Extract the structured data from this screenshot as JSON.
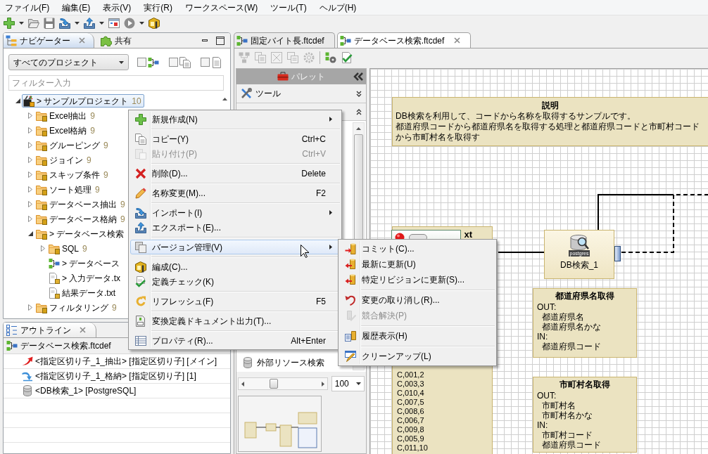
{
  "menu_bar": [
    "ファイル(F)",
    "編集(E)",
    "表示(V)",
    "実行(R)",
    "ワークスペース(W)",
    "ツール(T)",
    "ヘルプ(H)"
  ],
  "navigator": {
    "tabs": [
      {
        "kind": "navigator",
        "label": "ナビゲーター",
        "selected": true
      },
      {
        "kind": "share",
        "label": "共有",
        "selected": false
      }
    ],
    "project_scope": {
      "value": "すべてのプロジェクト"
    },
    "toggles": [
      {
        "kind": "flow",
        "checked": false
      },
      {
        "kind": "copy",
        "checked": false
      },
      {
        "kind": "doc",
        "checked": false
      }
    ],
    "filter": {
      "placeholder": "フィルター入力"
    },
    "tree": [
      {
        "kind": "project",
        "label": "> サンプルプロジェクト",
        "count": "10",
        "expanded": true,
        "selected": true,
        "children": [
          {
            "kind": "folder",
            "label": "Excel抽出",
            "count": "9",
            "expanded": false,
            "selected": false
          },
          {
            "kind": "folder",
            "label": "Excel格納",
            "count": "9",
            "expanded": false,
            "selected": false
          },
          {
            "kind": "folder",
            "label": "グルーピング",
            "count": "9",
            "expanded": false,
            "selected": false
          },
          {
            "kind": "folder",
            "label": "ジョイン",
            "count": "9",
            "expanded": false,
            "selected": false
          },
          {
            "kind": "folder",
            "label": "スキップ条件",
            "count": "9",
            "expanded": false,
            "selected": false
          },
          {
            "kind": "folder",
            "label": "ソート処理",
            "count": "9",
            "expanded": false,
            "selected": false
          },
          {
            "kind": "folder",
            "label": "データベース抽出",
            "count": "9",
            "expanded": false,
            "selected": false
          },
          {
            "kind": "folder",
            "label": "データベース格納",
            "count": "9",
            "expanded": false,
            "selected": false
          },
          {
            "kind": "folder",
            "label": "> データベース検索",
            "expanded": true,
            "selected": false,
            "children": [
              {
                "kind": "folder",
                "label": "SQL",
                "count": "9",
                "expanded": false,
                "selected": false
              },
              {
                "kind": "flow",
                "label": "> データベース",
                "selected": false
              },
              {
                "kind": "file",
                "label": "> 入力データ.tx",
                "selected": false
              },
              {
                "kind": "file",
                "label": "結果データ.txt",
                "selected": false
              }
            ]
          },
          {
            "kind": "folder",
            "label": "フィルタリング",
            "count": "9",
            "expanded": false,
            "selected": false
          }
        ]
      }
    ]
  },
  "outline": {
    "tab": {
      "label": "アウトライン"
    },
    "root": {
      "label": "データベース検索.ftcdef"
    },
    "items": [
      {
        "kind": "extract",
        "label": "<指定区切り子_1_抽出> [指定区切り子] [メイン]"
      },
      {
        "kind": "store",
        "label": "<指定区切り子_1_格納> [指定区切り子] [1]"
      },
      {
        "kind": "database",
        "label": "<DB検索_1> [PostgreSQL]"
      }
    ]
  },
  "editor": {
    "tabs": [
      {
        "label": "固定バイト長.ftcdef",
        "selected": false
      },
      {
        "label": "データベース検索.ftcdef",
        "selected": true
      }
    ],
    "toolbar": [
      {
        "kind": "arrange",
        "disabled": true
      },
      {
        "kind": "doc",
        "disabled": true
      },
      {
        "kind": "grid",
        "disabled": true
      },
      {
        "kind": "copy",
        "disabled": true
      },
      {
        "kind": "gear",
        "disabled": true
      },
      {
        "kind": "build",
        "disabled": false
      },
      {
        "kind": "check",
        "disabled": false
      }
    ],
    "palette": {
      "title": "パレット",
      "drawers": [
        {
          "label": "ツール",
          "expanded": false
        },
        {
          "expanded": true,
          "items": [
            {
              "label": "外部リソース検索"
            }
          ]
        }
      ],
      "zoom_slider": {
        "level": 0.35
      },
      "zoom": {
        "value": "100"
      }
    },
    "canvas": {
      "description": {
        "title": "説明",
        "lines": [
          "DB検索を利用して、コードから名称を取得するサンプルです。",
          "都道府県コードから都道府県名を取得する処理と都道府県コードと市町村コードから市町村名を取得す"
        ]
      },
      "input_note": {
        "title": "xt",
        "lines": [
          "C,001,2",
          "C,003,3",
          "C,010,4",
          "C,007,5",
          "C,008,6",
          "C,006,7",
          "C,009,8",
          "C,005,9",
          "C,011,10"
        ]
      },
      "db_node": {
        "label": "DB検索_1",
        "type_label": "postgres"
      },
      "notes": [
        {
          "title": "都道府県名取得",
          "sections": [
            {
              "label": "OUT:",
              "items": [
                "都道府県名",
                "都道府県名かな"
              ]
            },
            {
              "label": "IN:",
              "items": [
                "都道府県コード"
              ]
            }
          ]
        },
        {
          "title": "市町村名取得",
          "sections": [
            {
              "label": "OUT:",
              "items": [
                "市町村名",
                "市町村名かな"
              ]
            },
            {
              "label": "IN:",
              "items": [
                "市町村コード",
                "都道府県コード"
              ]
            }
          ]
        }
      ]
    }
  },
  "context_menu": {
    "groups": [
      [
        {
          "kind": "new",
          "label": "新規作成(N)",
          "has_submenu": true,
          "disabled": false,
          "selected": false
        }
      ],
      [
        {
          "kind": "copy",
          "label": "コピー(Y)",
          "shortcut": "Ctrl+C",
          "has_submenu": false,
          "disabled": false,
          "selected": false
        },
        {
          "kind": "paste",
          "label": "貼り付け(P)",
          "shortcut": "Ctrl+V",
          "has_submenu": false,
          "disabled": true,
          "selected": false
        }
      ],
      [
        {
          "kind": "delete",
          "label": "削除(D)...",
          "shortcut": "Delete",
          "has_submenu": false,
          "disabled": false,
          "selected": false
        }
      ],
      [
        {
          "kind": "rename",
          "label": "名称変更(M)...",
          "shortcut": "F2",
          "has_submenu": false,
          "disabled": false,
          "selected": false
        }
      ],
      [
        {
          "kind": "import",
          "label": "インポート(I)",
          "has_submenu": true,
          "disabled": false,
          "selected": false
        },
        {
          "kind": "export",
          "label": "エクスポート(E)...",
          "has_submenu": false,
          "disabled": false,
          "selected": false
        }
      ],
      [
        {
          "kind": "version",
          "label": "バージョン管理(V)",
          "has_submenu": true,
          "disabled": false,
          "selected": true
        }
      ],
      [
        {
          "kind": "build",
          "label": "編成(C)...",
          "has_submenu": false,
          "disabled": false,
          "selected": false
        },
        {
          "kind": "check",
          "label": "定義チェック(K)",
          "has_submenu": false,
          "disabled": false,
          "selected": false
        }
      ],
      [
        {
          "kind": "refresh",
          "label": "リフレッシュ(F)",
          "shortcut": "F5",
          "has_submenu": false,
          "disabled": false,
          "selected": false
        }
      ],
      [
        {
          "kind": "document",
          "label": "変換定義ドキュメント出力(T)...",
          "has_submenu": false,
          "disabled": false,
          "selected": false
        }
      ],
      [
        {
          "kind": "properties",
          "label": "プロパティ(R)...",
          "shortcut": "Alt+Enter",
          "has_submenu": false,
          "disabled": false,
          "selected": false
        }
      ]
    ]
  },
  "submenu": {
    "groups": [
      [
        {
          "kind": "commit",
          "label": "コミット(C)...",
          "has_submenu": false,
          "disabled": false,
          "selected": false
        },
        {
          "kind": "update",
          "label": "最新に更新(U)",
          "has_submenu": false,
          "disabled": false,
          "selected": false
        },
        {
          "kind": "update",
          "label": "特定リビジョンに更新(S)...",
          "has_submenu": false,
          "disabled": false,
          "selected": false
        }
      ],
      [
        {
          "kind": "revert",
          "label": "変更の取り消し(R)...",
          "has_submenu": false,
          "disabled": false,
          "selected": false
        },
        {
          "kind": "resolve",
          "label": "競合解決(P)",
          "has_submenu": false,
          "disabled": true,
          "selected": false
        }
      ],
      [
        {
          "kind": "history",
          "label": "履歴表示(H)",
          "has_submenu": false,
          "disabled": false,
          "selected": false
        }
      ],
      [
        {
          "kind": "cleanup",
          "label": "クリーンアップ(L)",
          "has_submenu": false,
          "disabled": false,
          "selected": false
        }
      ]
    ]
  }
}
